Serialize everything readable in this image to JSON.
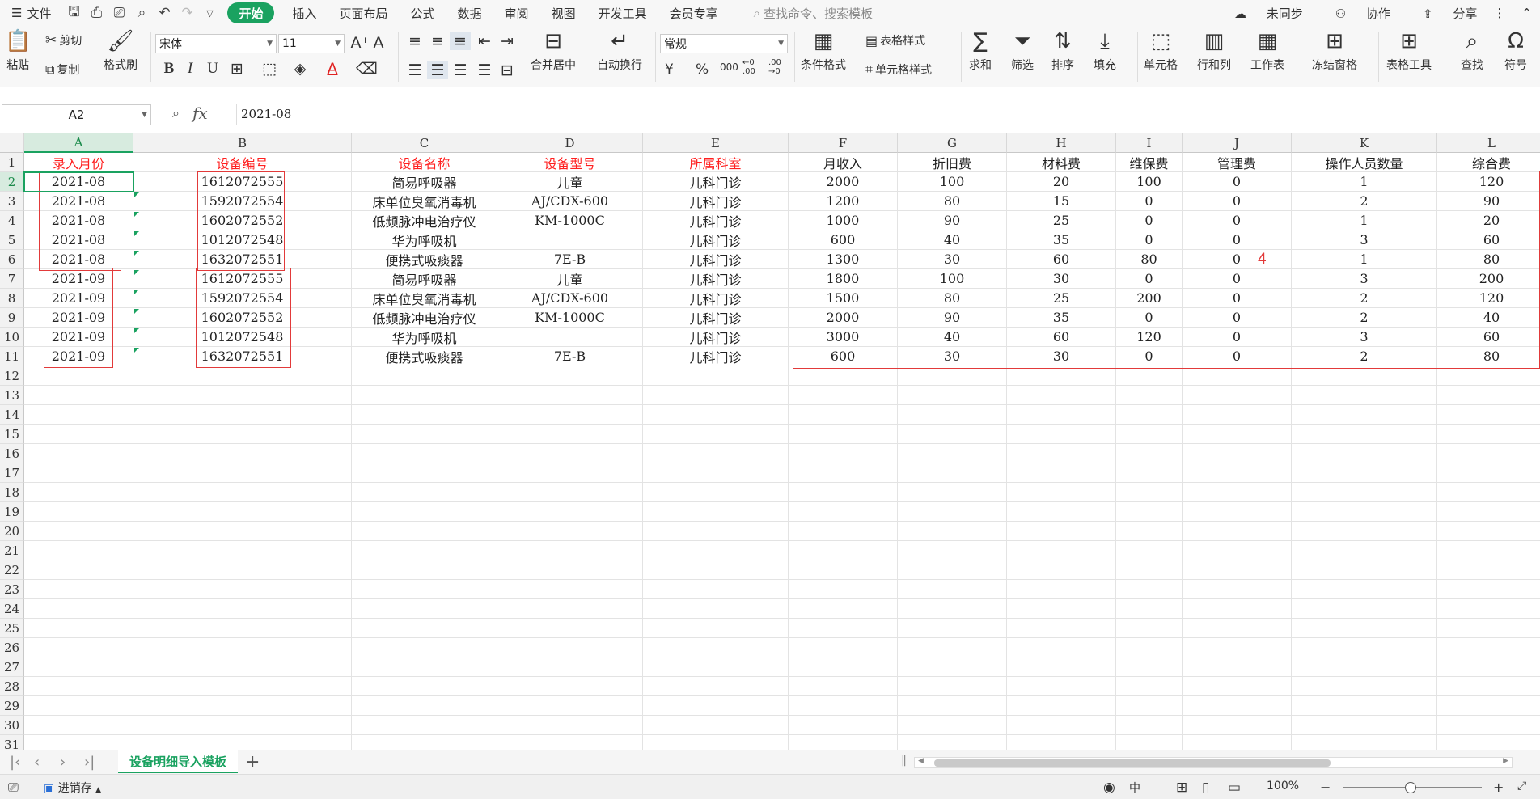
{
  "menu": {
    "file": "文件",
    "tabs": [
      "开始",
      "插入",
      "页面布局",
      "公式",
      "数据",
      "审阅",
      "视图",
      "开发工具",
      "会员专享"
    ],
    "search_placeholder": "查找命令、搜索模板",
    "sync": "未同步",
    "collab": "协作",
    "share": "分享"
  },
  "ribbon": {
    "paste": "粘贴",
    "cut": "剪切",
    "copy": "复制",
    "format_painter": "格式刷",
    "font_name": "宋体",
    "font_size": "11",
    "merge_center": "合并居中",
    "wrap_text": "自动换行",
    "number_format": "常规",
    "cond_format": "条件格式",
    "table_style": "表格样式",
    "cell_style": "单元格样式",
    "sum": "求和",
    "filter": "筛选",
    "sort": "排序",
    "fill": "填充",
    "cell": "单元格",
    "row_col": "行和列",
    "worksheet": "工作表",
    "freeze": "冻结窗格",
    "table_tools": "表格工具",
    "find": "查找",
    "symbol": "符号",
    "currency": "¥",
    "percent": "%",
    "thousands": "000",
    "dec_inc": "←0 .00",
    "dec_dec": ".00 →0"
  },
  "formula_bar": {
    "name_box": "A2",
    "fx": "fx",
    "value": "2021-08"
  },
  "columns": [
    "A",
    "B",
    "C",
    "D",
    "E",
    "F",
    "G",
    "H",
    "I",
    "J",
    "K",
    "L"
  ],
  "headers": [
    "录入月份",
    "设备编号",
    "设备名称",
    "设备型号",
    "所属科室",
    "月收入",
    "折旧费",
    "材料费",
    "维保费",
    "管理费",
    "操作人员数量",
    "综合费"
  ],
  "rows": [
    [
      "2021-08",
      "1612072555",
      "简易呼吸器",
      "儿童",
      "儿科门诊",
      "2000",
      "100",
      "20",
      "100",
      "0",
      "1",
      "120"
    ],
    [
      "2021-08",
      "1592072554",
      "床单位臭氧消毒机",
      "AJ/CDX-600",
      "儿科门诊",
      "1200",
      "80",
      "15",
      "0",
      "0",
      "2",
      "90"
    ],
    [
      "2021-08",
      "1602072552",
      "低频脉冲电治疗仪",
      "KM-1000C",
      "儿科门诊",
      "1000",
      "90",
      "25",
      "0",
      "0",
      "1",
      "20"
    ],
    [
      "2021-08",
      "1012072548",
      "华为呼吸机",
      "",
      "儿科门诊",
      "600",
      "40",
      "35",
      "0",
      "0",
      "3",
      "60"
    ],
    [
      "2021-08",
      "1632072551",
      "便携式吸痰器",
      "7E-B",
      "儿科门诊",
      "1300",
      "30",
      "60",
      "80",
      "0",
      "1",
      "80"
    ],
    [
      "2021-09",
      "1612072555",
      "简易呼吸器",
      "儿童",
      "儿科门诊",
      "1800",
      "100",
      "30",
      "0",
      "0",
      "3",
      "200"
    ],
    [
      "2021-09",
      "1592072554",
      "床单位臭氧消毒机",
      "AJ/CDX-600",
      "儿科门诊",
      "1500",
      "80",
      "25",
      "200",
      "0",
      "2",
      "120"
    ],
    [
      "2021-09",
      "1602072552",
      "低频脉冲电治疗仪",
      "KM-1000C",
      "儿科门诊",
      "2000",
      "90",
      "35",
      "0",
      "0",
      "2",
      "40"
    ],
    [
      "2021-09",
      "1012072548",
      "华为呼吸机",
      "",
      "儿科门诊",
      "3000",
      "40",
      "60",
      "120",
      "0",
      "3",
      "60"
    ],
    [
      "2021-09",
      "1632072551",
      "便携式吸痰器",
      "7E-B",
      "儿科门诊",
      "600",
      "30",
      "30",
      "0",
      "0",
      "2",
      "80"
    ]
  ],
  "row_numbers": [
    "1",
    "2",
    "3",
    "4",
    "5",
    "6",
    "7",
    "8",
    "9",
    "10",
    "11",
    "12",
    "13",
    "14",
    "15",
    "16",
    "17",
    "18",
    "19",
    "20",
    "21",
    "22",
    "23",
    "24",
    "25",
    "26",
    "27",
    "28",
    "29",
    "30",
    "31"
  ],
  "annotation": "4",
  "sheet_tab": "设备明细导入模板",
  "status": {
    "sheet_mode": "进销存",
    "zoom": "100%"
  },
  "colors": {
    "accent": "#1aa260",
    "header_red": "#ff2020",
    "annotation_red": "#e23a3a"
  }
}
